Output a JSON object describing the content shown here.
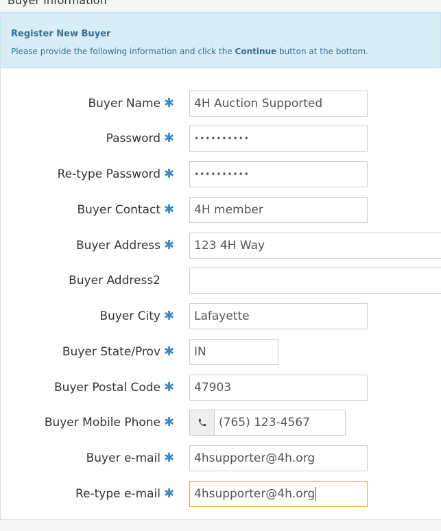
{
  "panel": {
    "title": "Buyer Information"
  },
  "info": {
    "heading": "Register New Buyer",
    "text_before": "Please provide the following information and click the ",
    "text_bold": "Continue",
    "text_after": " button at the bottom."
  },
  "required_marker": "✱",
  "fields": {
    "buyer_name": {
      "label": "Buyer Name",
      "value": "4H Auction Supported"
    },
    "password": {
      "label": "Password",
      "value": "••••••••••"
    },
    "retype_password": {
      "label": "Re-type Password",
      "value": "••••••••••"
    },
    "buyer_contact": {
      "label": "Buyer Contact",
      "value": "4H member"
    },
    "buyer_address": {
      "label": "Buyer Address",
      "value": "123 4H Way"
    },
    "buyer_address2": {
      "label": "Buyer Address2",
      "value": ""
    },
    "buyer_city": {
      "label": "Buyer City",
      "value": "Lafayette"
    },
    "buyer_state": {
      "label": "Buyer State/Prov",
      "value": "IN"
    },
    "buyer_postal": {
      "label": "Buyer Postal Code",
      "value": "47903"
    },
    "buyer_mobile": {
      "label": "Buyer Mobile Phone",
      "value": "(765) 123-4567"
    },
    "buyer_email": {
      "label": "Buyer e-mail",
      "value": "4hsupporter@4h.org"
    },
    "retype_email": {
      "label": "Re-type e-mail",
      "value": "4hsupporter@4h.org"
    }
  },
  "icons": {
    "phone": "phone-icon",
    "required": "asterisk-icon"
  },
  "colors": {
    "info_bg": "#d9edf7",
    "info_text": "#31708f",
    "required": "#3a87c8",
    "focus_border": "#e8a44a"
  }
}
